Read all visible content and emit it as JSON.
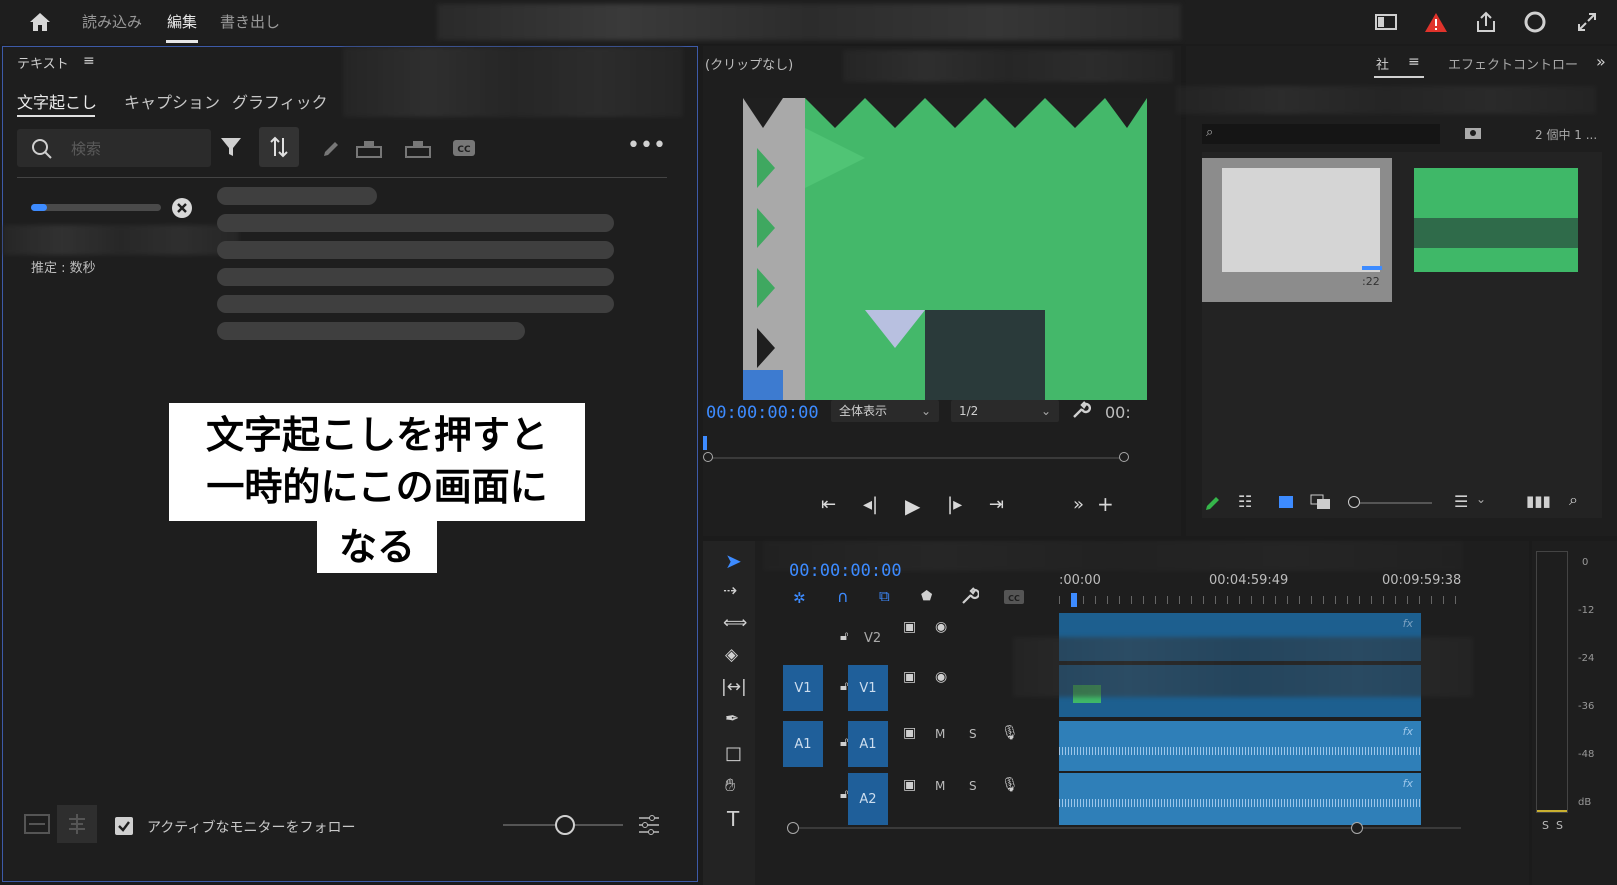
{
  "topbar": {
    "tabs": [
      "読み込み",
      "編集",
      "書き出し"
    ],
    "active_tab": "編集"
  },
  "text_panel": {
    "title": "テキスト",
    "subtabs": [
      "文字起こし",
      "キャプション",
      "グラフィック"
    ],
    "search_placeholder": "検索",
    "estimate": "推定 : 数秒",
    "follow_label": "アクティブなモニターをフォロー",
    "follow_checked": true,
    "progress": 0.12
  },
  "callout": {
    "lines": [
      "文字起こしを押すと",
      "一時的にこの画面に",
      "なる"
    ]
  },
  "program_monitor": {
    "title": "(クリップなし)",
    "timecode": "00:00:00:00",
    "fit_option": "全体表示",
    "resolution": "1/2",
    "duration_partial": "00:"
  },
  "project_panel": {
    "tab_partial": "社",
    "effect_controls_tab": "エフェクトコントロー",
    "count_label": "2 個中 1 ...",
    "clip_duration": ":22"
  },
  "timeline": {
    "timecode": "00:00:00:00",
    "ruler": [
      ":00:00",
      "00:04:59:49",
      "00:09:59:38"
    ],
    "tracks": {
      "v2": "V2",
      "v1_src": "V1",
      "v1": "V1",
      "a1_src": "A1",
      "a1": "A1",
      "a2": "A2",
      "mute": "M",
      "solo": "S",
      "fx": "fx"
    }
  },
  "meter": {
    "labels": [
      "0",
      "-12",
      "-24",
      "-36",
      "-48",
      "dB"
    ],
    "solo": [
      "S",
      "S"
    ]
  },
  "colors": {
    "accent": "#3d8bff",
    "track_blue": "#1f5f9a",
    "clip_blue": "#1d5f8f",
    "panel_border": "#3d5aa8",
    "warning": "#e0332b",
    "preview_green": "#3fb868"
  }
}
